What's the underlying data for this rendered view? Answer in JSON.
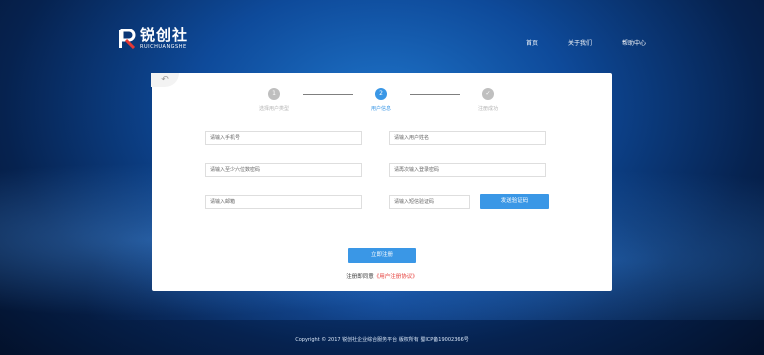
{
  "brand": {
    "name_cn": "锐创社",
    "name_en": "RUICHUANGSHE"
  },
  "nav": {
    "items": [
      "首页",
      "关于我们",
      "帮助中心"
    ]
  },
  "card": {
    "back_icon": "↶"
  },
  "steps": [
    {
      "number": "1",
      "label": "选择用户类型"
    },
    {
      "number": "2",
      "label": "用户信息"
    },
    {
      "number": "✓",
      "label": "注册成功"
    }
  ],
  "form": {
    "phone_placeholder": "请输入手机号",
    "username_placeholder": "请输入用户姓名",
    "password_placeholder": "请输入至少六位数密码",
    "confirm_placeholder": "请再次输入登录密码",
    "email_placeholder": "请输入邮箱",
    "sms_placeholder": "请输入短信验证码",
    "send_code_label": "发送验证码",
    "submit_label": "立即注册",
    "agree_prefix": "注册即同意",
    "agree_link": "《用户注册协议》"
  },
  "footer": {
    "text": "Copyright © 2017 锐创社企业综合服务平台   版权所有   蜀ICP备19002366号"
  },
  "colors": {
    "accent": "#3a97e6",
    "link_red": "#e53935"
  }
}
